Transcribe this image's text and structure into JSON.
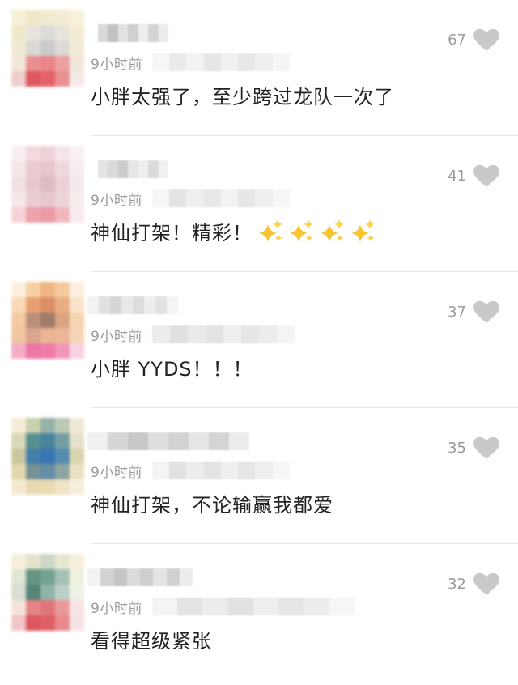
{
  "comments": [
    {
      "time": "9小时前",
      "text": "小胖太强了，至少跨过龙队一次了",
      "likes": "67",
      "sparkles": 0,
      "avatar": [
        "#f6f0d2",
        "#eee7c6",
        "#f1ead0",
        "#f3ecd1",
        "#f6f1da",
        "#efe8c8",
        "#e7e2dd",
        "#dcdad8",
        "#e8e3da",
        "#f3ecd3",
        "#f0e9d0",
        "#d9d7d5",
        "#c9c8c8",
        "#ddd9d4",
        "#f1ebd3",
        "#f3e6d9",
        "#e98b8c",
        "#e97f83",
        "#ec9c9b",
        "#f2e5da",
        "#efcccc",
        "#dd5058",
        "#e45a60",
        "#e88a8c",
        "#f4e9e6"
      ],
      "name_blur": [
        "#ffffff",
        "#d8d8d8",
        "#c2c2c2",
        "#e2e2e2",
        "#cfcfcf",
        "#eeeeee",
        "#d4d4d4",
        "#ececec"
      ],
      "meta_blur": [
        "#f7f7f7",
        "#eaeaea",
        "#f2f2f2",
        "#e6e6e6",
        "#f0f0f0",
        "#e8e8e8",
        "#efefef",
        "#f5f5f5"
      ]
    },
    {
      "time": "9小时前",
      "text": "神仙打架！精彩！",
      "likes": "41",
      "sparkles": 4,
      "avatar": [
        "#f7eef0",
        "#f1d8dc",
        "#eed1d6",
        "#f5e4e7",
        "#f8f1f2",
        "#f5e6e8",
        "#e8c9cf",
        "#e4c3c9",
        "#efd6da",
        "#f6ecee",
        "#f0dfe2",
        "#e5c7cd",
        "#dcbac1",
        "#e9cfd4",
        "#f4e8ea",
        "#f5e7e9",
        "#e9cbd1",
        "#e5c5cb",
        "#ecd3d8",
        "#f6ecee",
        "#f7d0d4",
        "#ed9ea5",
        "#eb96a0",
        "#f2b4ba",
        "#f8eaec"
      ],
      "name_blur": [
        "#ffffff",
        "#e4e4e4",
        "#d9d9d9",
        "#cccccc",
        "#e6e6e6",
        "#eeeeee",
        "#dadada",
        "#f0f0f0"
      ],
      "meta_blur": [
        "#f6f6f6",
        "#e4e4e4",
        "#eeeeee",
        "#e8e8e8",
        "#f2f2f2",
        "#e6e6e6",
        "#eeeeee",
        "#f6f6f6"
      ]
    },
    {
      "time": "9小时前",
      "text": "小胖 YYDS！！！",
      "likes": "37",
      "sparkles": 0,
      "avatar": [
        "#fbeedd",
        "#f6cfa0",
        "#efb27e",
        "#f5c89a",
        "#fbeedf",
        "#f8d9b3",
        "#e89a6c",
        "#d98a5e",
        "#eaa97c",
        "#f9e3c9",
        "#f3c89c",
        "#b98a72",
        "#9c7563",
        "#d9a07c",
        "#f6d4ad",
        "#f0c39d",
        "#d7a088",
        "#eab090",
        "#edb393",
        "#f5d3b4",
        "#f5a9c5",
        "#ee6fa2",
        "#ef75a6",
        "#f290b7",
        "#f8d0df"
      ],
      "name_blur": [
        "#f2f2f2",
        "#e0e0e0",
        "#d6d6d6",
        "#e8e8e8",
        "#dcdcdc",
        "#eeeeee",
        "#e2e2e2",
        "#f4f4f4"
      ],
      "meta_blur": [
        "#ececec",
        "#e0e0e0",
        "#eaeaea",
        "#e4e4e4",
        "#eeeeee",
        "#e6e6e6",
        "#ececec",
        "#f4f4f4"
      ]
    },
    {
      "time": "9小时前",
      "text": "神仙打架，不论输赢我都爱",
      "likes": "35",
      "sparkles": 0,
      "avatar": [
        "#f3ecd6",
        "#c8cfaa",
        "#8fb0a5",
        "#b9c7b2",
        "#efe8d2",
        "#d7d6b6",
        "#4f8b8c",
        "#3f7f96",
        "#6c9aa0",
        "#e4e0c9",
        "#c8c49a",
        "#3d78a6",
        "#2f6fb0",
        "#4e86ad",
        "#d8d3ad",
        "#e0d6a8",
        "#6e8e90",
        "#5d87a2",
        "#8aa19c",
        "#e9e1c2",
        "#f4e9cf",
        "#e7d8b0",
        "#ead9ae",
        "#efe2c2",
        "#f6eedb"
      ],
      "name_blur": [
        "#f0f0f0",
        "#d6d6d6",
        "#c8c8c8",
        "#dedede",
        "#d2d2d2",
        "#e6e6e6",
        "#d4d4d4",
        "#ececec"
      ],
      "meta_blur": [
        "#f4f4f4",
        "#e2e2e2",
        "#ececec",
        "#e4e4e4",
        "#efefef",
        "#e6e6e6",
        "#eeeeee",
        "#f6f6f6"
      ]
    },
    {
      "time": "9小时前",
      "text": "看得超级紧张",
      "likes": "32",
      "sparkles": 0,
      "avatar": [
        "#f6efd8",
        "#e3e3c8",
        "#c9d6c6",
        "#e6e5ce",
        "#f6f0da",
        "#dfe4d2",
        "#5d8f7e",
        "#6f9e8d",
        "#a0bfb0",
        "#eef0e0",
        "#d6ddd0",
        "#4e7e6f",
        "#8cb0a3",
        "#b8cfc4",
        "#eef1e5",
        "#f4e1da",
        "#e27e7f",
        "#e06f73",
        "#e99496",
        "#f6e4e1",
        "#f2c2c3",
        "#db4f57",
        "#de575e",
        "#e88387",
        "#f6e2e2"
      ],
      "name_blur": [
        "#f2f2f2",
        "#d2d2d2",
        "#c6c6c6",
        "#dcdcdc",
        "#cecece",
        "#e4e4e4",
        "#d0d0d0",
        "#ececec"
      ],
      "meta_blur": [
        "#f4f4f4",
        "#e4e4e4",
        "#ececec",
        "#e2e2e2",
        "#eeeeee",
        "#e6e6e6",
        "#ececec",
        "#f6f6f6"
      ]
    }
  ]
}
